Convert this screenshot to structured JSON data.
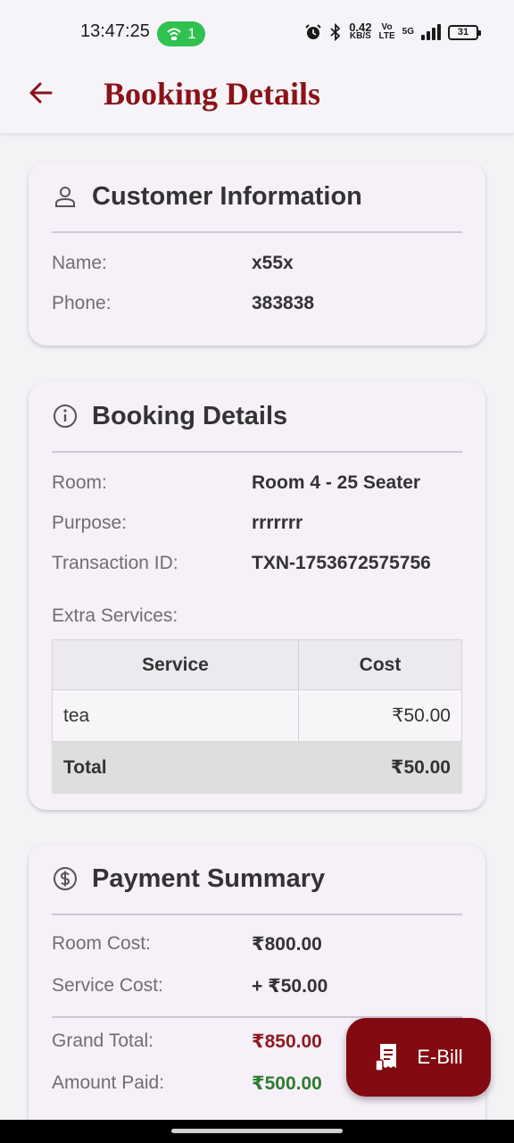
{
  "status_bar": {
    "time": "13:47:25",
    "hotspot_count": "1",
    "net_speed_value": "0.42",
    "net_speed_unit": "KB/S",
    "vo_label": "Vo",
    "lte_label": "LTE",
    "network_label": "5G",
    "battery": "31"
  },
  "app_bar": {
    "title": "Booking Details"
  },
  "customer_info": {
    "title": "Customer Information",
    "name_label": "Name:",
    "name_value": "x55x",
    "phone_label": "Phone:",
    "phone_value": "383838"
  },
  "booking_details": {
    "title": "Booking Details",
    "room_label": "Room:",
    "room_value": "Room 4 - 25 Seater",
    "purpose_label": "Purpose:",
    "purpose_value": "rrrrrrr",
    "txn_label": "Transaction ID:",
    "txn_value": "TXN-1753672575756",
    "extra_services_label": "Extra Services:",
    "table": {
      "col_service": "Service",
      "col_cost": "Cost",
      "rows": [
        {
          "service": "tea",
          "cost": "₹50.00"
        }
      ],
      "total_label": "Total",
      "total_value": "₹50.00"
    }
  },
  "payment_summary": {
    "title": "Payment Summary",
    "room_cost_label": "Room Cost:",
    "room_cost_value": "₹800.00",
    "service_cost_label": "Service Cost:",
    "service_cost_value": "+ ₹50.00",
    "grand_total_label": "Grand Total:",
    "grand_total_value": "₹850.00",
    "amount_paid_label": "Amount Paid:",
    "amount_paid_value": "₹500.00"
  },
  "fab": {
    "label": "E-Bill"
  },
  "colors": {
    "brand": "#8a1218",
    "card_bg": "#f6f0f8",
    "grand_total": "#8e1b1e",
    "amount_paid": "#2e7d32"
  }
}
